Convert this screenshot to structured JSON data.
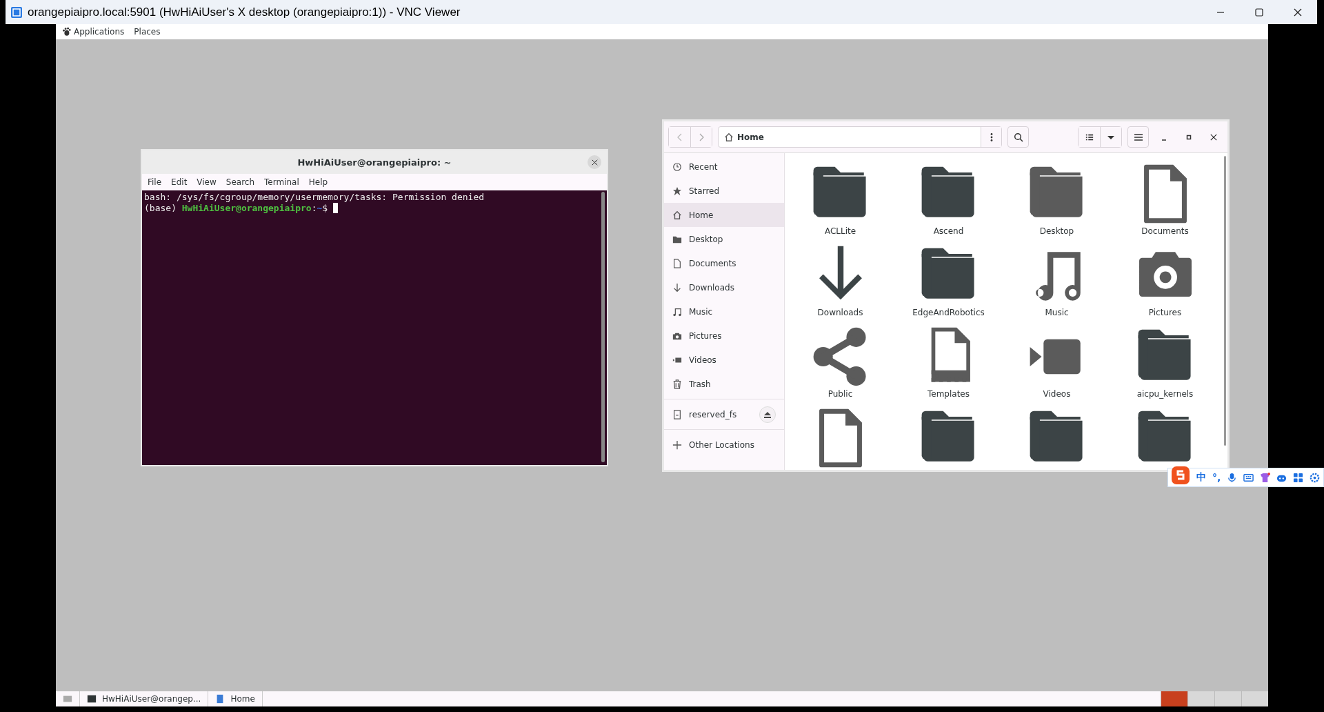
{
  "vnc_window": {
    "title": "orangepiaipro.local:5901 (HwHiAiUser's X desktop (orangepiaipro:1)) - VNC Viewer"
  },
  "top_panel": {
    "menus": [
      "Applications",
      "Places"
    ]
  },
  "terminal": {
    "title": "HwHiAiUser@orangepiaipro: ~",
    "menu": [
      "File",
      "Edit",
      "View",
      "Search",
      "Terminal",
      "Help"
    ],
    "output": [
      "bash: /sys/fs/cgroup/memory/usermemory/tasks: Permission denied"
    ],
    "prompt": [
      {
        "kind": "plain",
        "text": "(base) "
      },
      {
        "kind": "user",
        "text": "HwHiAiUser@orangepiaipro"
      },
      {
        "kind": "plain",
        "text": ":"
      },
      {
        "kind": "path",
        "text": "~"
      },
      {
        "kind": "plain",
        "text": "$ "
      }
    ]
  },
  "files": {
    "back_disabled": true,
    "location": "Home",
    "sidebar": [
      {
        "kind": "recent",
        "label": "Recent",
        "selected": false
      },
      {
        "kind": "star",
        "label": "Starred",
        "selected": false
      },
      {
        "kind": "home",
        "label": "Home",
        "selected": true
      },
      {
        "kind": "folder",
        "label": "Desktop",
        "selected": false
      },
      {
        "kind": "document",
        "label": "Documents",
        "selected": false
      },
      {
        "kind": "download",
        "label": "Downloads",
        "selected": false
      },
      {
        "kind": "music",
        "label": "Music",
        "selected": false
      },
      {
        "kind": "camera",
        "label": "Pictures",
        "selected": false
      },
      {
        "kind": "video",
        "label": "Videos",
        "selected": false
      },
      {
        "kind": "trash",
        "label": "Trash",
        "selected": false
      }
    ],
    "devices": [
      {
        "kind": "drive",
        "label": "reserved_fs"
      }
    ],
    "other": {
      "kind": "plus",
      "label": "Other Locations"
    },
    "items": [
      {
        "kind": "folder",
        "label": "ACLLite"
      },
      {
        "kind": "folder",
        "label": "Ascend"
      },
      {
        "kind": "folder-light",
        "label": "Desktop"
      },
      {
        "kind": "document",
        "label": "Documents"
      },
      {
        "kind": "download",
        "label": "Downloads"
      },
      {
        "kind": "folder",
        "label": "EdgeAndRobotics"
      },
      {
        "kind": "music",
        "label": "Music"
      },
      {
        "kind": "camera",
        "label": "Pictures"
      },
      {
        "kind": "share",
        "label": "Public"
      },
      {
        "kind": "template",
        "label": "Templates"
      },
      {
        "kind": "video",
        "label": "Videos"
      },
      {
        "kind": "folder",
        "label": "aicpu_kernels"
      },
      {
        "kind": "document"
      },
      {
        "kind": "folder"
      },
      {
        "kind": "folder"
      },
      {
        "kind": "folder"
      }
    ]
  },
  "taskbar": {
    "tasks": [
      {
        "kind": "terminal",
        "label": "HwHiAiUser@orangep..."
      },
      {
        "kind": "files",
        "label": "Home"
      }
    ],
    "workspaces": [
      {
        "selected": true
      },
      {
        "selected": false
      },
      {
        "selected": false
      },
      {
        "selected": false
      }
    ]
  },
  "ime_toolbar": {
    "mode": "中",
    "punctuation": "°,"
  }
}
